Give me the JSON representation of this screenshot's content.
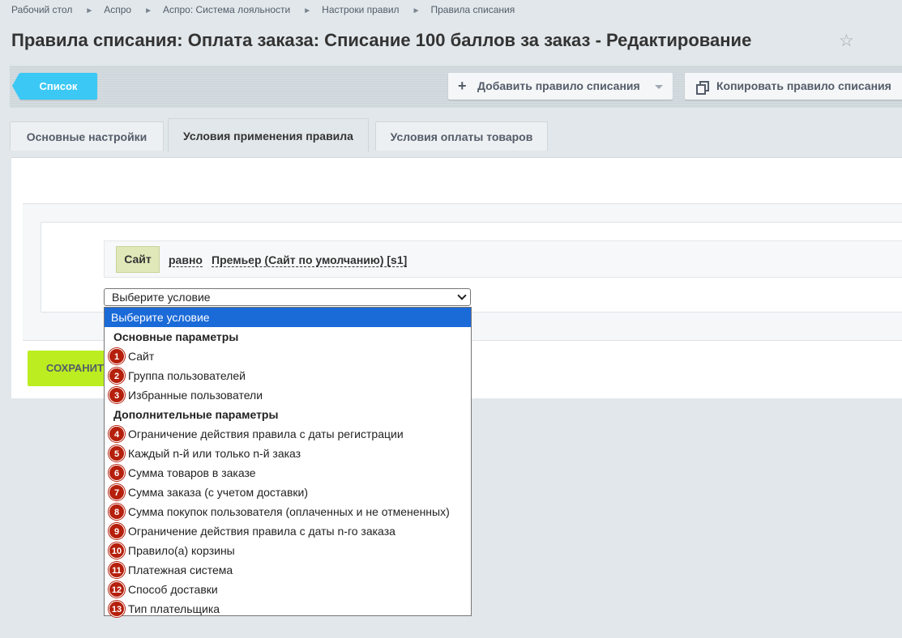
{
  "breadcrumb": {
    "items": [
      "Рабочий стол",
      "Аспро",
      "Аспро: Система лояльности",
      "Настроки правил",
      "Правила списания"
    ],
    "separator": "►"
  },
  "page_title": "Правила списания: Оплата заказа: Списание 100 баллов за заказ - Редактирование",
  "icons": {
    "favorite": "star-icon",
    "add": "plus-icon",
    "copy": "copy-icon",
    "dropdown": "chevron-down-icon"
  },
  "toolbar": {
    "list_label": "Список",
    "add_label": "Добавить правило списания",
    "copy_label": "Копировать правило списания"
  },
  "tabs": [
    {
      "label": "Основные настройки",
      "active": false
    },
    {
      "label": "Условия применения правила",
      "active": true
    },
    {
      "label": "Условия оплаты товаров",
      "active": false
    }
  ],
  "condition": {
    "field": "Сайт",
    "operator": "равно",
    "value": "Премьер (Сайт по умолчанию) [s1]"
  },
  "select": {
    "current": "Выберите условие",
    "options": [
      {
        "type": "selected",
        "label": "Выберите условие"
      },
      {
        "type": "group",
        "label": "Основные параметры"
      },
      {
        "type": "item",
        "num": "1",
        "label": "Сайт"
      },
      {
        "type": "item",
        "num": "2",
        "label": "Группа пользователей"
      },
      {
        "type": "item",
        "num": "3",
        "label": "Избранные пользователи"
      },
      {
        "type": "group",
        "label": "Дополнительные параметры"
      },
      {
        "type": "item",
        "num": "4",
        "label": "Ограничение действия правила с даты регистрации"
      },
      {
        "type": "item",
        "num": "5",
        "label": "Каждый n-й или только n-й заказ"
      },
      {
        "type": "item",
        "num": "6",
        "label": "Сумма товаров в заказе"
      },
      {
        "type": "item",
        "num": "7",
        "label": "Сумма заказа (с учетом доставки)"
      },
      {
        "type": "item",
        "num": "8",
        "label": "Сумма покупок пользователя (оплаченных и не отмененных)"
      },
      {
        "type": "item",
        "num": "9",
        "label": "Ограничение действия правила с даты n-го заказа"
      },
      {
        "type": "item",
        "num": "10",
        "label": "Правило(а) корзины"
      },
      {
        "type": "item",
        "num": "11",
        "label": "Платежная система"
      },
      {
        "type": "item",
        "num": "12",
        "label": "Способ доставки"
      },
      {
        "type": "item",
        "num": "13",
        "label": "Тип плательщика"
      }
    ]
  },
  "save_label": "СОХРАНИТЬ",
  "colors": {
    "accent": "#3bc8f5",
    "save": "#bbed21",
    "selected": "#1a6ad8",
    "badge": "#b51f0c"
  }
}
